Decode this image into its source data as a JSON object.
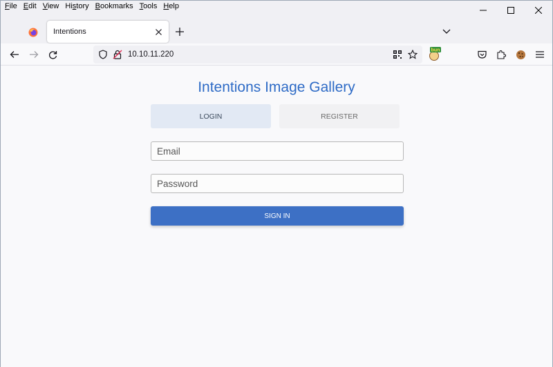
{
  "menu": [
    {
      "key": "F",
      "rest": "ile"
    },
    {
      "key": "E",
      "rest": "dit"
    },
    {
      "key": "V",
      "rest": "iew"
    },
    {
      "pre": "Hi",
      "key": "s",
      "rest": "tory"
    },
    {
      "key": "B",
      "rest": "ookmarks"
    },
    {
      "key": "T",
      "rest": "ools"
    },
    {
      "key": "H",
      "rest": "elp"
    }
  ],
  "tabs": [
    {
      "title": "Intentions"
    }
  ],
  "address": {
    "url": "10.10.11.220"
  },
  "extension": {
    "label": "bun"
  },
  "page": {
    "title": "Intentions Image Gallery",
    "login_tab": "LOGIN",
    "register_tab": "REGISTER",
    "email_placeholder": "Email",
    "password_placeholder": "Password",
    "signin_label": "SIGN IN"
  },
  "colors": {
    "accent": "#3d70c5",
    "title": "#2e6bc6",
    "login_tab_bg": "#e2e9f4"
  }
}
